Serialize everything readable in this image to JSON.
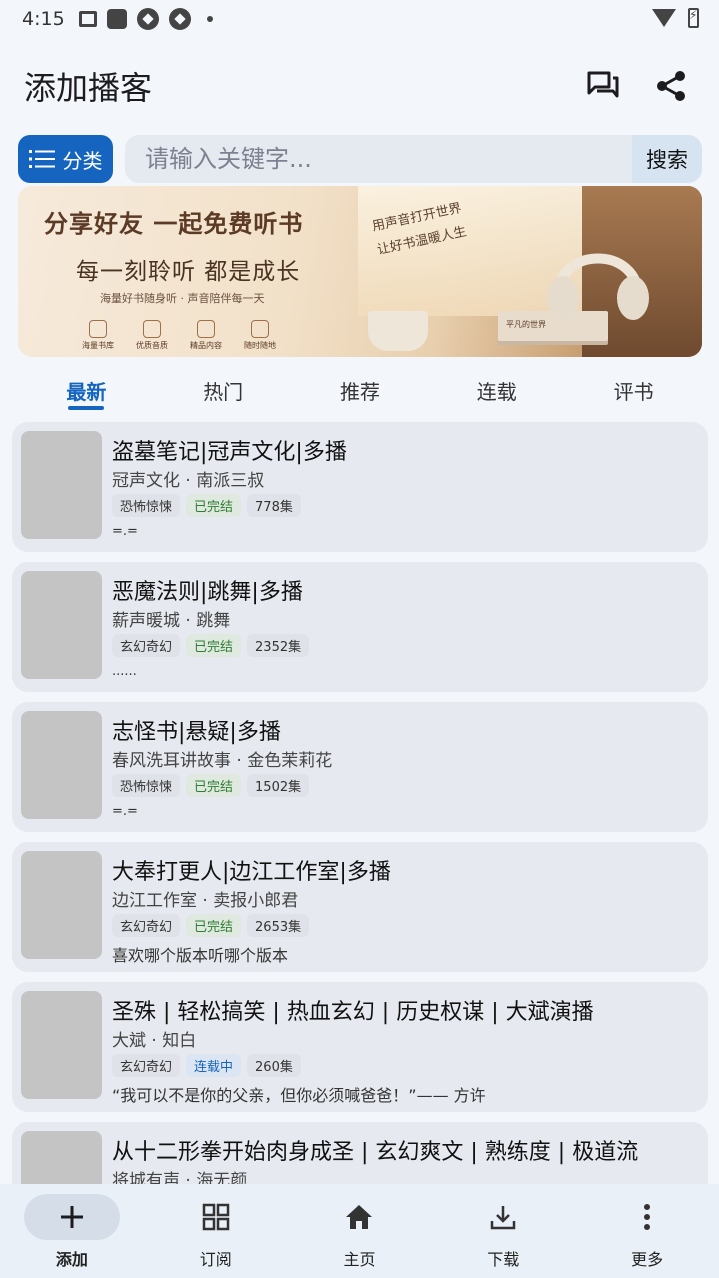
{
  "status_bar": {
    "time": "4:15"
  },
  "app_bar": {
    "title": "添加播客"
  },
  "search": {
    "category_label": "分类",
    "placeholder": "请输入关键字...",
    "button_label": "搜索"
  },
  "banner": {
    "headline": "分享好友  一起免费听书",
    "subtitle": "每一刻聆听 都是成长",
    "small_text": "海量好书随身听 · 声音陪伴每一天",
    "handwritten": [
      "用声音打开世界",
      "让好书温暖人生"
    ],
    "features": [
      "海量书库",
      "优质音质",
      "精品内容",
      "随时随地"
    ],
    "book_label": "平凡的世界"
  },
  "tabs": [
    {
      "label": "最新",
      "active": true
    },
    {
      "label": "热门",
      "active": false
    },
    {
      "label": "推荐",
      "active": false
    },
    {
      "label": "连载",
      "active": false
    },
    {
      "label": "评书",
      "active": false
    }
  ],
  "podcasts": [
    {
      "title": "盗墓笔记|冠声文化|多播",
      "authors": "冠声文化 · 南派三叔",
      "genre": "恐怖惊悚",
      "status": "已完结",
      "status_type": "done",
      "episodes": "778集",
      "desc": "=.=",
      "desc_small": true
    },
    {
      "title": "恶魔法则|跳舞|多播",
      "authors": "薪声暖城 · 跳舞",
      "genre": "玄幻奇幻",
      "status": "已完结",
      "status_type": "done",
      "episodes": "2352集",
      "desc": "......",
      "desc_small": true
    },
    {
      "title": "志怪书|悬疑|多播",
      "authors": "春风洗耳讲故事 · 金色茉莉花",
      "genre": "恐怖惊悚",
      "status": "已完结",
      "status_type": "done",
      "episodes": "1502集",
      "desc": "=.=",
      "desc_small": true
    },
    {
      "title": "大奉打更人|边江工作室|多播",
      "authors": "边江工作室 · 卖报小郎君",
      "genre": "玄幻奇幻",
      "status": "已完结",
      "status_type": "done",
      "episodes": "2653集",
      "desc": "喜欢哪个版本听哪个版本",
      "desc_small": false
    },
    {
      "title": "圣殊 | 轻松搞笑 | 热血玄幻 | 历史权谋 | 大斌演播",
      "authors": "大斌 · 知白",
      "genre": "玄幻奇幻",
      "status": "连载中",
      "status_type": "ongoing",
      "episodes": "260集",
      "desc": "“我可以不是你的父亲，但你必须喊爸爸！”—— 方许",
      "desc_small": false
    },
    {
      "title": "从十二形拳开始肉身成圣 | 玄幻爽文 | 熟练度 | 极道流",
      "authors": "将城有声 · 海无颜",
      "genre": "",
      "status": "",
      "status_type": "",
      "episodes": "",
      "desc": "",
      "desc_small": false
    }
  ],
  "bottom_nav": [
    {
      "label": "添加",
      "icon": "plus-icon",
      "active": true
    },
    {
      "label": "订阅",
      "icon": "grid-icon",
      "active": false
    },
    {
      "label": "主页",
      "icon": "home-icon",
      "active": false
    },
    {
      "label": "下载",
      "icon": "download-icon",
      "active": false
    },
    {
      "label": "更多",
      "icon": "more-vertical-icon",
      "active": false
    }
  ],
  "colors": {
    "accent": "#1565c0",
    "done": "#2e7d32",
    "card_bg": "#e6e9ef",
    "page_bg": "#f3f6fb"
  }
}
